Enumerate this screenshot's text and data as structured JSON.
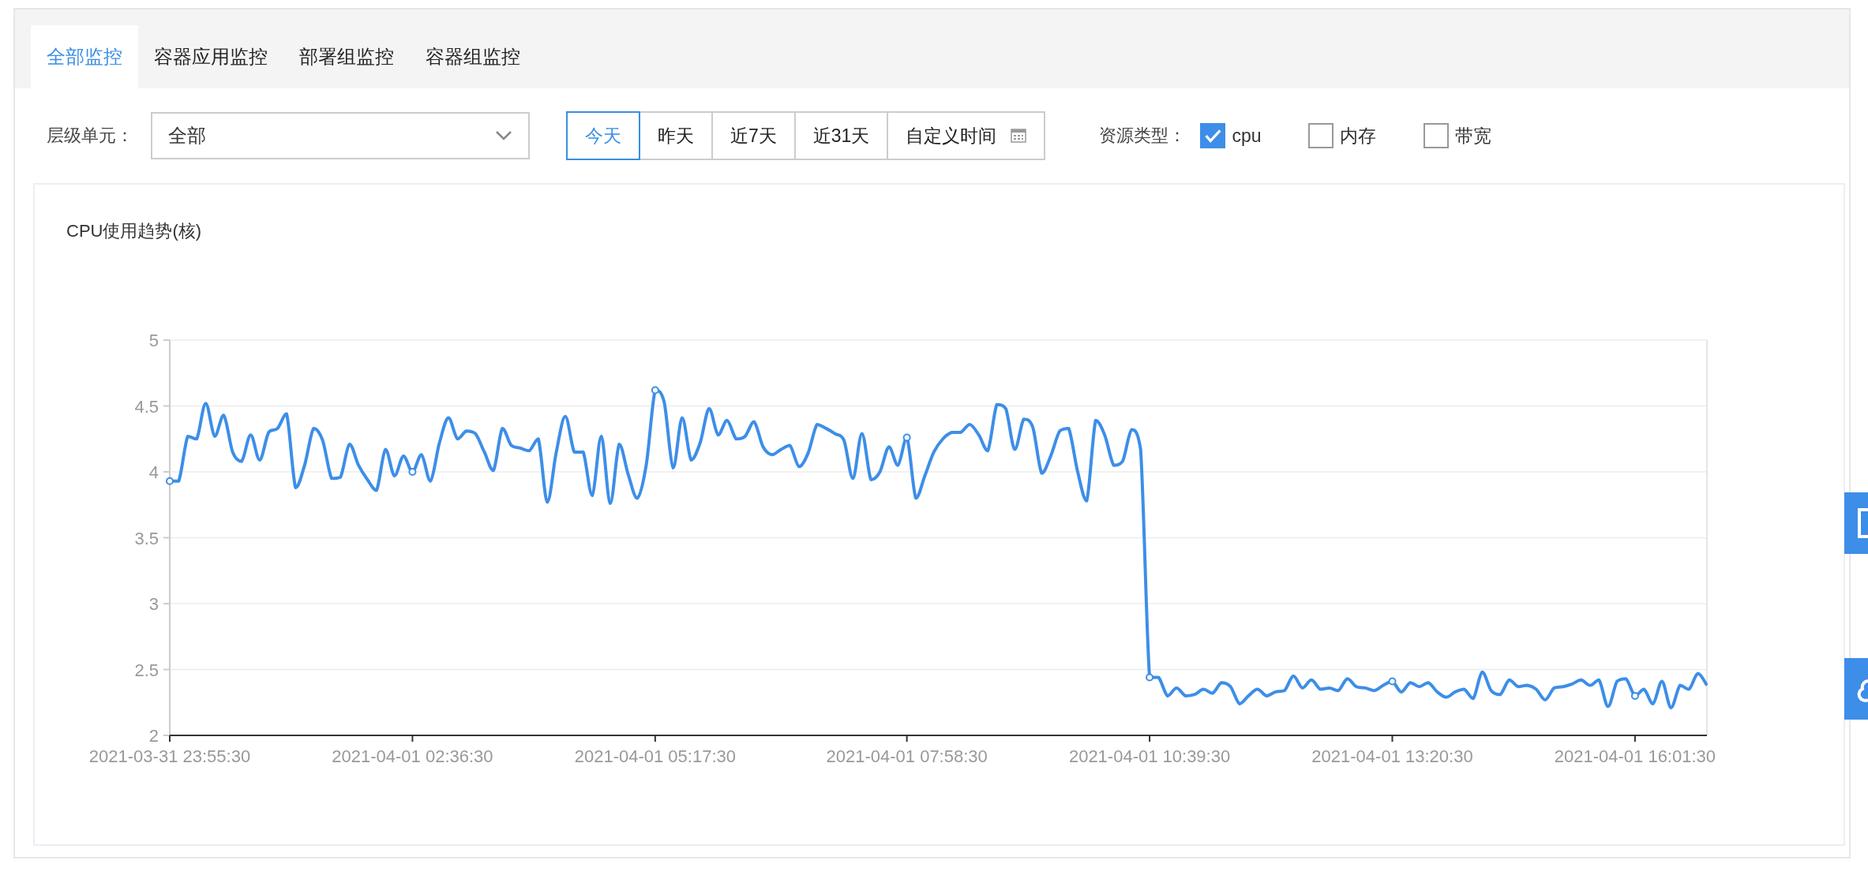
{
  "tabs": [
    {
      "label": "全部监控",
      "selected": true
    },
    {
      "label": "容器应用监控",
      "selected": false
    },
    {
      "label": "部署组监控",
      "selected": false
    },
    {
      "label": "容器组监控",
      "selected": false
    }
  ],
  "filters": {
    "level_label": "层级单元：",
    "level_value": "全部",
    "date_ranges": [
      {
        "label": "今天",
        "selected": true,
        "kind": "preset"
      },
      {
        "label": "昨天",
        "selected": false,
        "kind": "preset"
      },
      {
        "label": "近7天",
        "selected": false,
        "kind": "preset"
      },
      {
        "label": "近31天",
        "selected": false,
        "kind": "preset"
      },
      {
        "label": "自定义时间",
        "selected": false,
        "kind": "custom"
      }
    ],
    "resource_label": "资源类型：",
    "resources": [
      {
        "label": "cpu",
        "checked": true
      },
      {
        "label": "内存",
        "checked": false
      },
      {
        "label": "带宽",
        "checked": false
      }
    ]
  },
  "chart": {
    "title": "CPU使用趋势(核)",
    "chart_data": {
      "type": "line",
      "grid": true,
      "ylim": [
        2,
        5
      ],
      "categories": [
        "2021-03-31 23:55:30",
        null,
        null,
        null,
        null,
        null,
        null,
        null,
        null,
        null,
        null,
        null,
        null,
        null,
        null,
        null,
        null,
        null,
        null,
        null,
        null,
        null,
        null,
        null,
        null,
        null,
        null,
        "2021-04-01 02:36:30",
        null,
        null,
        null,
        null,
        null,
        null,
        null,
        null,
        null,
        null,
        null,
        null,
        null,
        null,
        null,
        null,
        null,
        null,
        null,
        null,
        null,
        null,
        null,
        null,
        null,
        null,
        "2021-04-01 05:17:30",
        null,
        null,
        null,
        null,
        null,
        null,
        null,
        null,
        null,
        null,
        null,
        null,
        null,
        null,
        null,
        null,
        null,
        null,
        null,
        null,
        null,
        null,
        null,
        null,
        null,
        null,
        null,
        "2021-04-01 07:58:30",
        null,
        null,
        null,
        null,
        null,
        null,
        null,
        null,
        null,
        null,
        null,
        null,
        null,
        null,
        null,
        null,
        null,
        null,
        null,
        null,
        null,
        null,
        null,
        null,
        null,
        null,
        "2021-04-01 10:39:30",
        null,
        null,
        null,
        null,
        null,
        null,
        null,
        null,
        null,
        null,
        null,
        null,
        null,
        null,
        null,
        null,
        null,
        null,
        null,
        null,
        null,
        null,
        null,
        null,
        null,
        null,
        "2021-04-01 13:20:30",
        null,
        null,
        null,
        null,
        null,
        null,
        null,
        null,
        null,
        null,
        null,
        null,
        null,
        null,
        null,
        null,
        null,
        null,
        null,
        null,
        null,
        null,
        null,
        null,
        null,
        null,
        "2021-04-01 16:01:30",
        null,
        null,
        null,
        null,
        null,
        null,
        null,
        null
      ],
      "yticks": [
        2,
        2.5,
        3,
        3.5,
        4,
        4.5,
        5
      ],
      "series": [
        {
          "color": "#3d8ee8",
          "values": [
            3.93,
            3.93,
            4.27,
            4.25,
            4.52,
            4.27,
            4.43,
            4.15,
            4.08,
            4.28,
            4.09,
            4.3,
            4.33,
            4.44,
            3.88,
            4.05,
            4.33,
            4.24,
            3.95,
            3.96,
            4.21,
            4.05,
            3.94,
            3.86,
            4.17,
            3.97,
            4.12,
            4.0,
            4.13,
            3.93,
            4.22,
            4.41,
            4.25,
            4.31,
            4.29,
            4.15,
            4.01,
            4.33,
            4.2,
            4.18,
            4.16,
            4.25,
            3.77,
            4.15,
            4.42,
            4.15,
            4.15,
            3.82,
            4.27,
            3.76,
            4.21,
            3.98,
            3.8,
            4.05,
            4.62,
            4.53,
            4.03,
            4.41,
            4.09,
            4.22,
            4.48,
            4.28,
            4.39,
            4.25,
            4.27,
            4.38,
            4.19,
            4.13,
            4.17,
            4.2,
            4.04,
            4.14,
            4.36,
            4.33,
            4.29,
            4.24,
            3.95,
            4.29,
            3.94,
            4.0,
            4.19,
            4.05,
            4.26,
            3.8,
            3.97,
            4.15,
            4.25,
            4.3,
            4.3,
            4.36,
            4.28,
            4.16,
            4.51,
            4.48,
            4.17,
            4.4,
            4.34,
            3.99,
            4.12,
            4.31,
            4.33,
            4.0,
            3.78,
            4.39,
            4.28,
            4.05,
            4.08,
            4.32,
            4.17,
            2.44,
            2.44,
            2.3,
            2.36,
            2.3,
            2.31,
            2.35,
            2.32,
            2.4,
            2.37,
            2.24,
            2.3,
            2.35,
            2.3,
            2.33,
            2.34,
            2.45,
            2.36,
            2.42,
            2.35,
            2.36,
            2.34,
            2.43,
            2.37,
            2.36,
            2.34,
            2.38,
            2.41,
            2.33,
            2.4,
            2.37,
            2.4,
            2.33,
            2.29,
            2.33,
            2.35,
            2.28,
            2.48,
            2.34,
            2.31,
            2.42,
            2.37,
            2.38,
            2.35,
            2.27,
            2.36,
            2.37,
            2.39,
            2.42,
            2.38,
            2.42,
            2.22,
            2.41,
            2.43,
            2.3,
            2.35,
            2.24,
            2.41,
            2.21,
            2.38,
            2.35,
            2.47,
            2.38
          ]
        }
      ]
    }
  }
}
